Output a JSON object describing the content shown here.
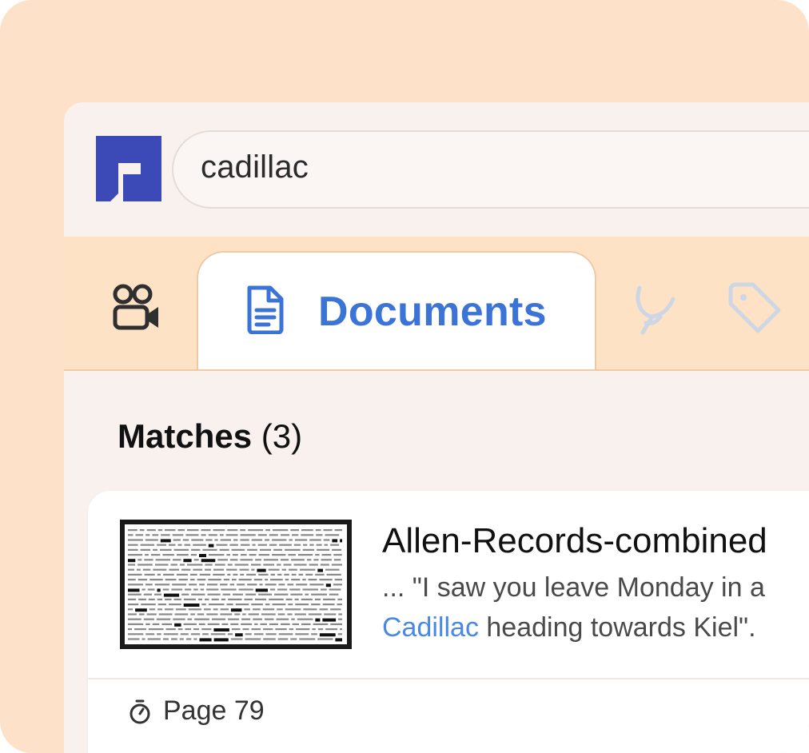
{
  "search": {
    "value": "cadillac"
  },
  "tabs": [
    {
      "id": "video",
      "icon": "video-camera-icon"
    },
    {
      "id": "documents",
      "icon": "document-icon",
      "label": "Documents",
      "active": true
    },
    {
      "id": "tools",
      "icon": "stethoscope-icon"
    },
    {
      "id": "tags",
      "icon": "tag-icon"
    }
  ],
  "results": {
    "heading": "Matches",
    "count": "(3)",
    "items": [
      {
        "title": "Allen-Records-combined",
        "snippet_line1": "... \"I saw you leave Monday in a",
        "snippet_highlight": "Cadillac",
        "snippet_rest": " heading towards Kiel\".",
        "page_label": "Page 79",
        "page_icon": "stopwatch-icon"
      }
    ]
  },
  "colors": {
    "accent": "#3c73d6",
    "highlight": "#4a88e6",
    "logo": "#3c4ab8",
    "tab_bar": "#fde2c6",
    "outer_background": "#fde1c8"
  }
}
